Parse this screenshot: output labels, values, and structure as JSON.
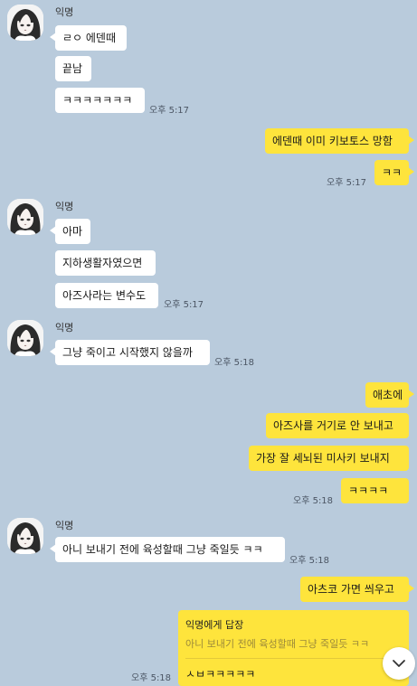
{
  "colors": {
    "background": "#b9cbdc",
    "incoming_bubble": "#ffffff",
    "outgoing_bubble": "#fee43c"
  },
  "messages": [
    {
      "sender": "익명",
      "texts": [
        "ㄹㅇ 에덴때",
        "끝남",
        "ㅋㅋㅋㅋㅋㅋㅋ"
      ],
      "time": "오후 5:17"
    },
    {
      "texts": [
        "에덴때 이미 키보토스 망함"
      ]
    },
    {
      "texts": [
        "ㅋㅋ"
      ],
      "time": "오후 5:17"
    },
    {
      "sender": "익명",
      "texts": [
        "아마",
        "지하생활자였으면",
        "아즈사라는 변수도"
      ],
      "time": "오후 5:17"
    },
    {
      "sender": "익명",
      "texts": [
        "그냥 죽이고 시작했지 않을까"
      ],
      "time": "오후 5:18"
    },
    {
      "texts": [
        "애초에",
        "아즈사를 거기로 안 보내고",
        "가장 잘 세뇌된 미사키 보내지",
        "ㅋㅋㅋㅋ"
      ],
      "time": "오후 5:18"
    },
    {
      "sender": "익명",
      "texts": [
        "아니 보내기 전에 육성할때 그냥 죽일듯 ㅋㅋ"
      ],
      "time": "오후 5:18"
    },
    {
      "texts": [
        "아츠코 가면 씌우고"
      ]
    }
  ],
  "reply": {
    "title": "익명에게 답장",
    "quote": "아니 보내기 전에 육성할때 그냥 죽일듯 ㅋㅋ",
    "text": "ㅅㅂㅋㅋㅋㅋㅋ",
    "time": "오후 5:18"
  },
  "icons": {
    "avatar": "anime-girl-avatar-icon",
    "scroll": "chevron-down-icon"
  }
}
